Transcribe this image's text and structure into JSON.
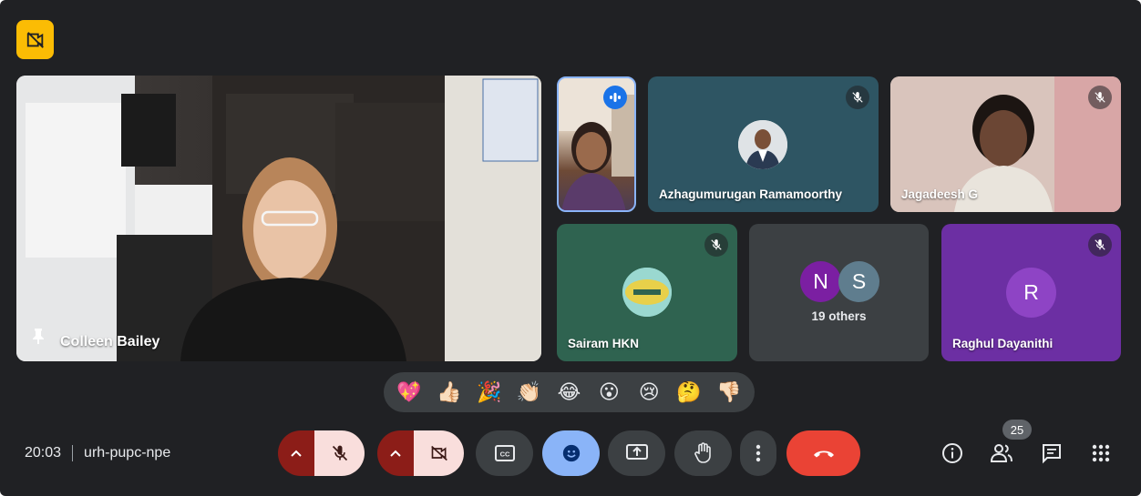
{
  "meeting": {
    "time": "20:03",
    "code": "urh-pupc-npe"
  },
  "participants": {
    "main": {
      "name": "Colleen Bailey",
      "pinned": true
    },
    "tiles": [
      {
        "name": "",
        "speaking": true
      },
      {
        "name": "Azhagumurugan Ramamoorthy",
        "muted": true
      },
      {
        "name": "Jagadeesh G",
        "muted": true
      },
      {
        "name": "Sairam HKN",
        "muted": true
      },
      {
        "name": "Raghul Dayanithi",
        "muted": true,
        "initial": "R"
      }
    ],
    "others": {
      "initials": [
        "N",
        "S"
      ],
      "label": "19 others"
    },
    "count": "25"
  },
  "reactions": [
    "💖",
    "👍🏻",
    "🎉",
    "👏🏻",
    "😂",
    "😮",
    "😢",
    "🤔",
    "👎🏻"
  ],
  "colors": {
    "background": "#202124",
    "control": "#3c4043",
    "mic_off_bg": "#f9dedc",
    "mic_off_left": "#8c1d18",
    "hangup": "#ea4335",
    "reaction_active": "#8ab4f8",
    "safety_badge": "#fbbc04",
    "avatar_n": "#7b1fa2",
    "avatar_s": "#5f7d8e",
    "avatar_r": "#8e44c5"
  },
  "icons": {
    "safety": "no-video-recording-icon",
    "pin": "pin-icon",
    "speaking": "audio-wave-icon",
    "mic_off": "mic-off-icon",
    "camera_off": "camera-off-icon",
    "captions": "closed-captions-icon",
    "emoji": "emoji-icon",
    "present": "present-screen-icon",
    "hand": "raise-hand-icon",
    "more": "more-vert-icon",
    "hangup": "call-end-icon",
    "info": "info-icon",
    "people": "people-icon",
    "chat": "chat-icon",
    "activities": "apps-grid-icon"
  }
}
